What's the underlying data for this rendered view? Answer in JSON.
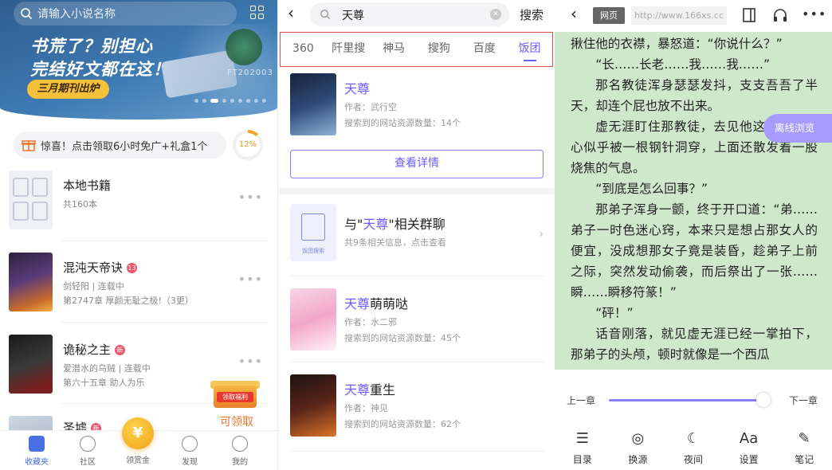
{
  "shelf": {
    "search_placeholder": "请输入小说名称",
    "banner": {
      "line1": "书荒了？别担心",
      "line2": "完结好文都在这！",
      "pill": "三月期刊出炉",
      "code": "FT202003"
    },
    "promo": {
      "text": "惊喜！点击领取6小时免广+礼盒1个",
      "progress_label": "12%",
      "progress": 0.12
    },
    "books": [
      {
        "title": "本地书籍",
        "meta1": "共160本",
        "meta2": "",
        "badge": ""
      },
      {
        "title": "混沌天帝诀",
        "meta1": "剑轻阳 | 连载中",
        "meta2": "第2747章 厚颜无耻之极!（3更）",
        "badge": "13"
      },
      {
        "title": "诡秘之主",
        "meta1": "爱潜水的乌贼 | 连载中",
        "meta2": "第六十五章 助人为乐",
        "badge": "新"
      },
      {
        "title": "圣墟",
        "meta1": "",
        "meta2": "",
        "badge": "新"
      }
    ],
    "gift": {
      "box_label": "领取福利",
      "cta": "可领取"
    },
    "tabs": [
      "收藏夹",
      "社区",
      "领赏金",
      "发现",
      "我的"
    ],
    "coin_symbol": "¥"
  },
  "search": {
    "query": "天尊",
    "submit": "搜索",
    "engines": [
      "360",
      "阡里搜",
      "神马",
      "搜狗",
      "百度",
      "饭团"
    ],
    "active_engine": "饭团",
    "results": [
      {
        "title_hl": "天尊",
        "title_rest": "",
        "author": "作者：武行空",
        "count": "搜索到的网站资源数量：14个"
      },
      {
        "title_hl": "天尊",
        "title_rest": "萌萌哒",
        "author": "作者：水二邪",
        "count": "搜索到的网站资源数量：45个"
      },
      {
        "title_hl": "天尊",
        "title_rest": "重生",
        "author": "作者：神见",
        "count": "搜索到的网站资源数量：62个"
      }
    ],
    "detail_btn": "查看详情",
    "group": {
      "prefix": "与\"",
      "hl": "天尊",
      "suffix": "\"相关群聊",
      "sub": "共9条相关信息，点击查看",
      "icon_label": "饭团搜索"
    }
  },
  "reader": {
    "web_label": "网页",
    "url": "http://www.166xs.cc",
    "paragraphs": [
      {
        "text": "揪住他的衣襟，暴怒道：“你说什么？”",
        "indent": false
      },
      {
        "text": "“长……长老……我……我……”",
        "indent": true
      },
      {
        "text": "那名教徒浑身瑟瑟发抖，支支吾吾了半天，却连个屁也放不出来。",
        "indent": true
      },
      {
        "text": "虚无涯盯住那教徒，去见他这副模样，心似乎被一根钢针洞穿，上面还散发着一股烧焦的气息。",
        "indent": true
      },
      {
        "text": "“到底是怎么回事？”",
        "indent": true
      },
      {
        "text": "那弟子浑身一颤，终于开口道：“弟……弟子一时色迷心窍，本来只是想占那女人的便宜，没成想那女子竟是装昏，趁弟子上前之际，突然发动偷袭，而后祭出了一张……瞬……瞬移符篆！”",
        "indent": true
      },
      {
        "text": "“砰！”",
        "indent": true
      },
      {
        "text": "话音刚落，就见虚无涯已经一掌拍下，那弟子的头颅，顿时就像是一个西瓜",
        "indent": true
      }
    ],
    "offline": "离线浏览",
    "prev": "上一章",
    "next": "下一章",
    "progress": 0.97,
    "tools": [
      {
        "label": "目录",
        "icon": "toc-icon"
      },
      {
        "label": "换源",
        "icon": "source-icon"
      },
      {
        "label": "夜间",
        "icon": "moon-icon"
      },
      {
        "label": "设置",
        "icon": "font-settings-icon"
      },
      {
        "label": "笔记",
        "icon": "note-icon"
      }
    ]
  },
  "colors": {
    "accent": "#6b5cff",
    "reader_bg": "#cfe8cc",
    "banner": "#3e7ab3",
    "gift": "#f0732a"
  }
}
